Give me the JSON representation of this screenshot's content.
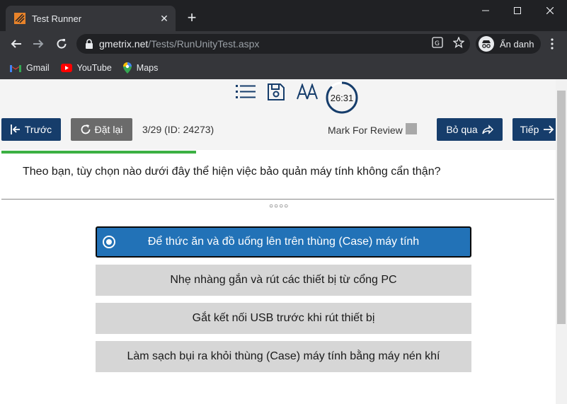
{
  "browser": {
    "tab_title": "Test Runner",
    "url_host": "gmetrix.net",
    "url_path": "/Tests/RunUnityTest.aspx",
    "profile_label": "Ẩn danh",
    "bookmarks": [
      {
        "label": "Gmail",
        "icon": "gmail-icon"
      },
      {
        "label": "YouTube",
        "icon": "youtube-icon"
      },
      {
        "label": "Maps",
        "icon": "maps-icon"
      }
    ]
  },
  "test": {
    "timer": "26:31",
    "timer_progress": 0.88,
    "prev_label": "Trước",
    "reset_label": "Đặt lại",
    "counter": "3/29 (ID: 24273)",
    "mark_review": "Mark For Review",
    "skip_label": "Bỏ qua",
    "next_label": "Tiếp",
    "progress_fraction": 0.35,
    "question": "Theo bạn, tùy chọn nào dưới đây thể hiện việc bảo quản máy tính không cẩn thận?",
    "pager_dots": "○○○○",
    "options": [
      "Để thức ăn và đồ uống lên trên thùng (Case) máy tính",
      "Nhẹ nhàng gắn và rút các thiết bị từ cổng PC",
      "Gắt kết nối USB trước khi rút thiết bị",
      "Làm sạch bụi ra khỏi thùng (Case) máy tính bằng máy nén khí"
    ],
    "selected_option": 0
  },
  "colors": {
    "accent_blue": "#2272b7",
    "button_dark": "#163d6b",
    "progress_green": "#3cb043"
  }
}
